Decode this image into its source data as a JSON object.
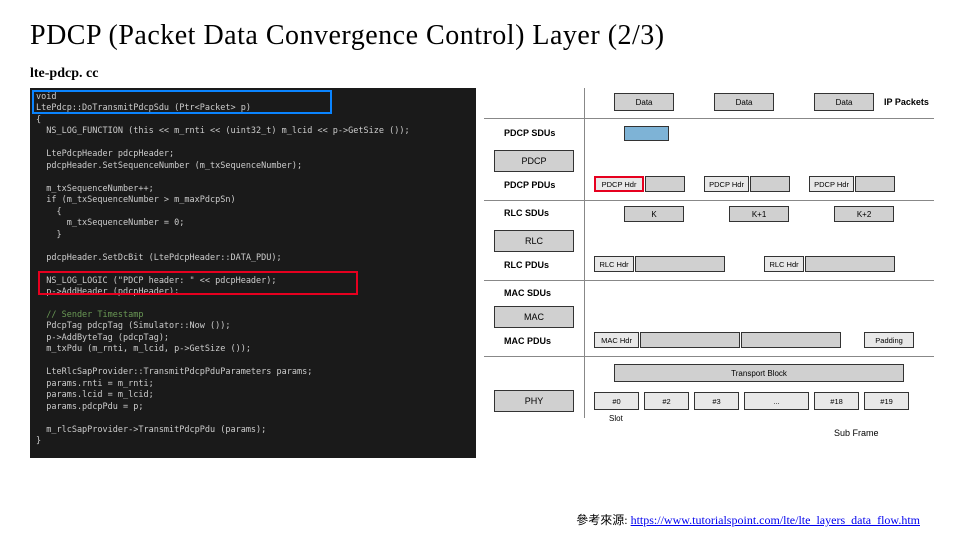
{
  "title": "PDCP (Packet Data Convergence Control) Layer (2/3)",
  "filename": "lte-pdcp. cc",
  "code": {
    "l1": "void",
    "l2": "LtePdcp::DoTransmitPdcpSdu (Ptr<Packet> p)",
    "l3": "{",
    "l4": "  NS_LOG_FUNCTION (this << m_rnti << (uint32_t) m_lcid << p->GetSize ());",
    "l5": "",
    "l6": "  LtePdcpHeader pdcpHeader;",
    "l7": "  pdcpHeader.SetSequenceNumber (m_txSequenceNumber);",
    "l8": "",
    "l9": "  m_txSequenceNumber++;",
    "l10": "  if (m_txSequenceNumber > m_maxPdcpSn)",
    "l11": "    {",
    "l12": "      m_txSequenceNumber = 0;",
    "l13": "    }",
    "l14": "",
    "l15": "  pdcpHeader.SetDcBit (LtePdcpHeader::DATA_PDU);",
    "l16": "",
    "l17": "  NS_LOG_LOGIC (\"PDCP header: \" << pdcpHeader);",
    "l18": "  p->AddHeader (pdcpHeader);",
    "l19": "",
    "l20": "  // Sender Timestamp",
    "l21": "  PdcpTag pdcpTag (Simulator::Now ());",
    "l22": "  p->AddByteTag (pdcpTag);",
    "l23": "  m_txPdu (m_rnti, m_lcid, p->GetSize ());",
    "l24": "",
    "l25": "  LteRlcSapProvider::TransmitPdcpPduParameters params;",
    "l26": "  params.rnti = m_rnti;",
    "l27": "  params.lcid = m_lcid;",
    "l28": "  params.pdcpPdu = p;",
    "l29": "",
    "l30": "  m_rlcSapProvider->TransmitPdcpPdu (params);",
    "l31": "}"
  },
  "diagram": {
    "ip": "IP Packets",
    "data": "Data",
    "layers": {
      "pdcp_sdus": "PDCP SDUs",
      "pdcp": "PDCP",
      "pdcp_pdus": "PDCP PDUs",
      "rlc_sdus": "RLC SDUs",
      "rlc": "RLC",
      "rlc_pdus": "RLC PDUs",
      "mac_sdus": "MAC SDUs",
      "mac": "MAC",
      "mac_pdus": "MAC PDUs",
      "phy": "PHY"
    },
    "hdrs": {
      "pdcp": "PDCP Hdr",
      "rlc": "RLC Hdr",
      "mac": "MAC Hdr",
      "padding": "Padding"
    },
    "k": {
      "k": "K",
      "k1": "K+1",
      "k2": "K+2"
    },
    "tb": "Transport Block",
    "slots": {
      "s0": "#0",
      "s1": "#2",
      "s2": "#3",
      "s3": "...",
      "s4": "#18",
      "s5": "#19",
      "label": "Slot"
    },
    "subframe": "Sub Frame"
  },
  "footer": {
    "label": "參考來源:",
    "link_text": "https://www.tutorialspoint.com/lte/lte_layers_data_flow.htm"
  }
}
